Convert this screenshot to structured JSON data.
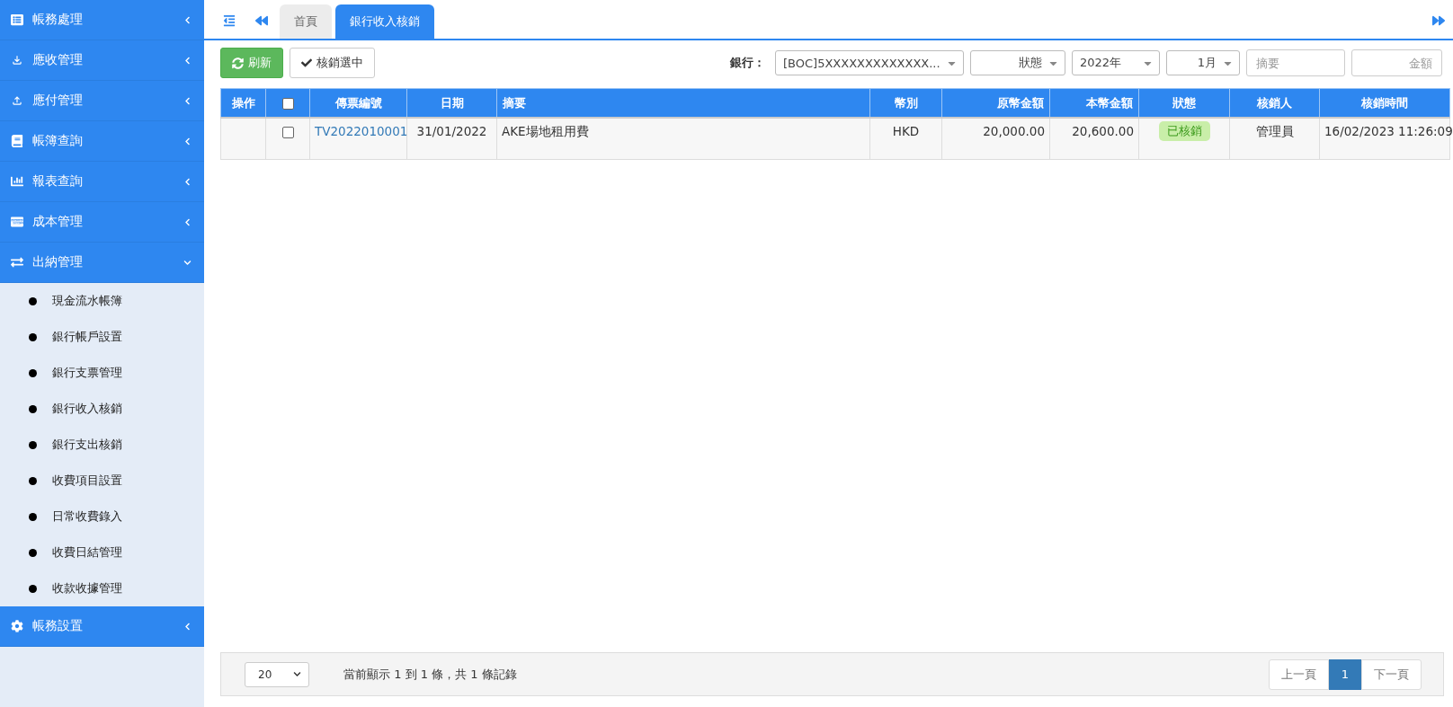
{
  "sidebar": {
    "items": [
      {
        "label": "帳務處理",
        "expanded": false
      },
      {
        "label": "應收管理",
        "expanded": false
      },
      {
        "label": "應付管理",
        "expanded": false
      },
      {
        "label": "帳簿查詢",
        "expanded": false
      },
      {
        "label": "報表查詢",
        "expanded": false
      },
      {
        "label": "成本管理",
        "expanded": false
      },
      {
        "label": "出納管理",
        "expanded": true,
        "children": [
          "現金流水帳簿",
          "銀行帳戶設置",
          "銀行支票管理",
          "銀行收入核銷",
          "銀行支出核銷",
          "收費項目設置",
          "日常收費錄入",
          "收費日結管理",
          "收款收據管理"
        ]
      },
      {
        "label": "帳務設置",
        "expanded": false
      }
    ]
  },
  "tabs": [
    {
      "label": "首頁",
      "selected": false
    },
    {
      "label": "銀行收入核銷",
      "selected": true
    }
  ],
  "toolbar": {
    "refresh": "刷新",
    "verify_selected": "核銷選中",
    "bank_label": "銀行：",
    "bank": "[BOC]5XXXXXXXXXXXXX...",
    "status": "狀態",
    "year": "2022年",
    "month": "1月",
    "summary": {
      "placeholder": "摘要"
    },
    "amount": {
      "placeholder": "金額"
    }
  },
  "table": {
    "columns": [
      "操作",
      "",
      "傳票編號",
      "日期",
      "摘要",
      "幣別",
      "原幣金額",
      "本幣金額",
      "狀態",
      "核銷人",
      "核銷時間"
    ],
    "header_checked": false,
    "rows": [
      {
        "checked": false,
        "voucher": "TV2022010001",
        "date": "31/01/2022",
        "summary": "AKE場地租用費",
        "currency": "HKD",
        "original_amount": "20,000.00",
        "local_amount": "20,600.00",
        "status": "已核銷",
        "verified": true,
        "verifier": "管理員",
        "verified_at": "16/02/2023 11:26:09"
      }
    ]
  },
  "footer": {
    "page_size": "20",
    "info": "當前顯示 1 到 1 條，共 1 條記錄",
    "prev": "上一頁",
    "pages": [
      {
        "label": "1",
        "selected": true
      }
    ],
    "next": "下一頁"
  }
}
